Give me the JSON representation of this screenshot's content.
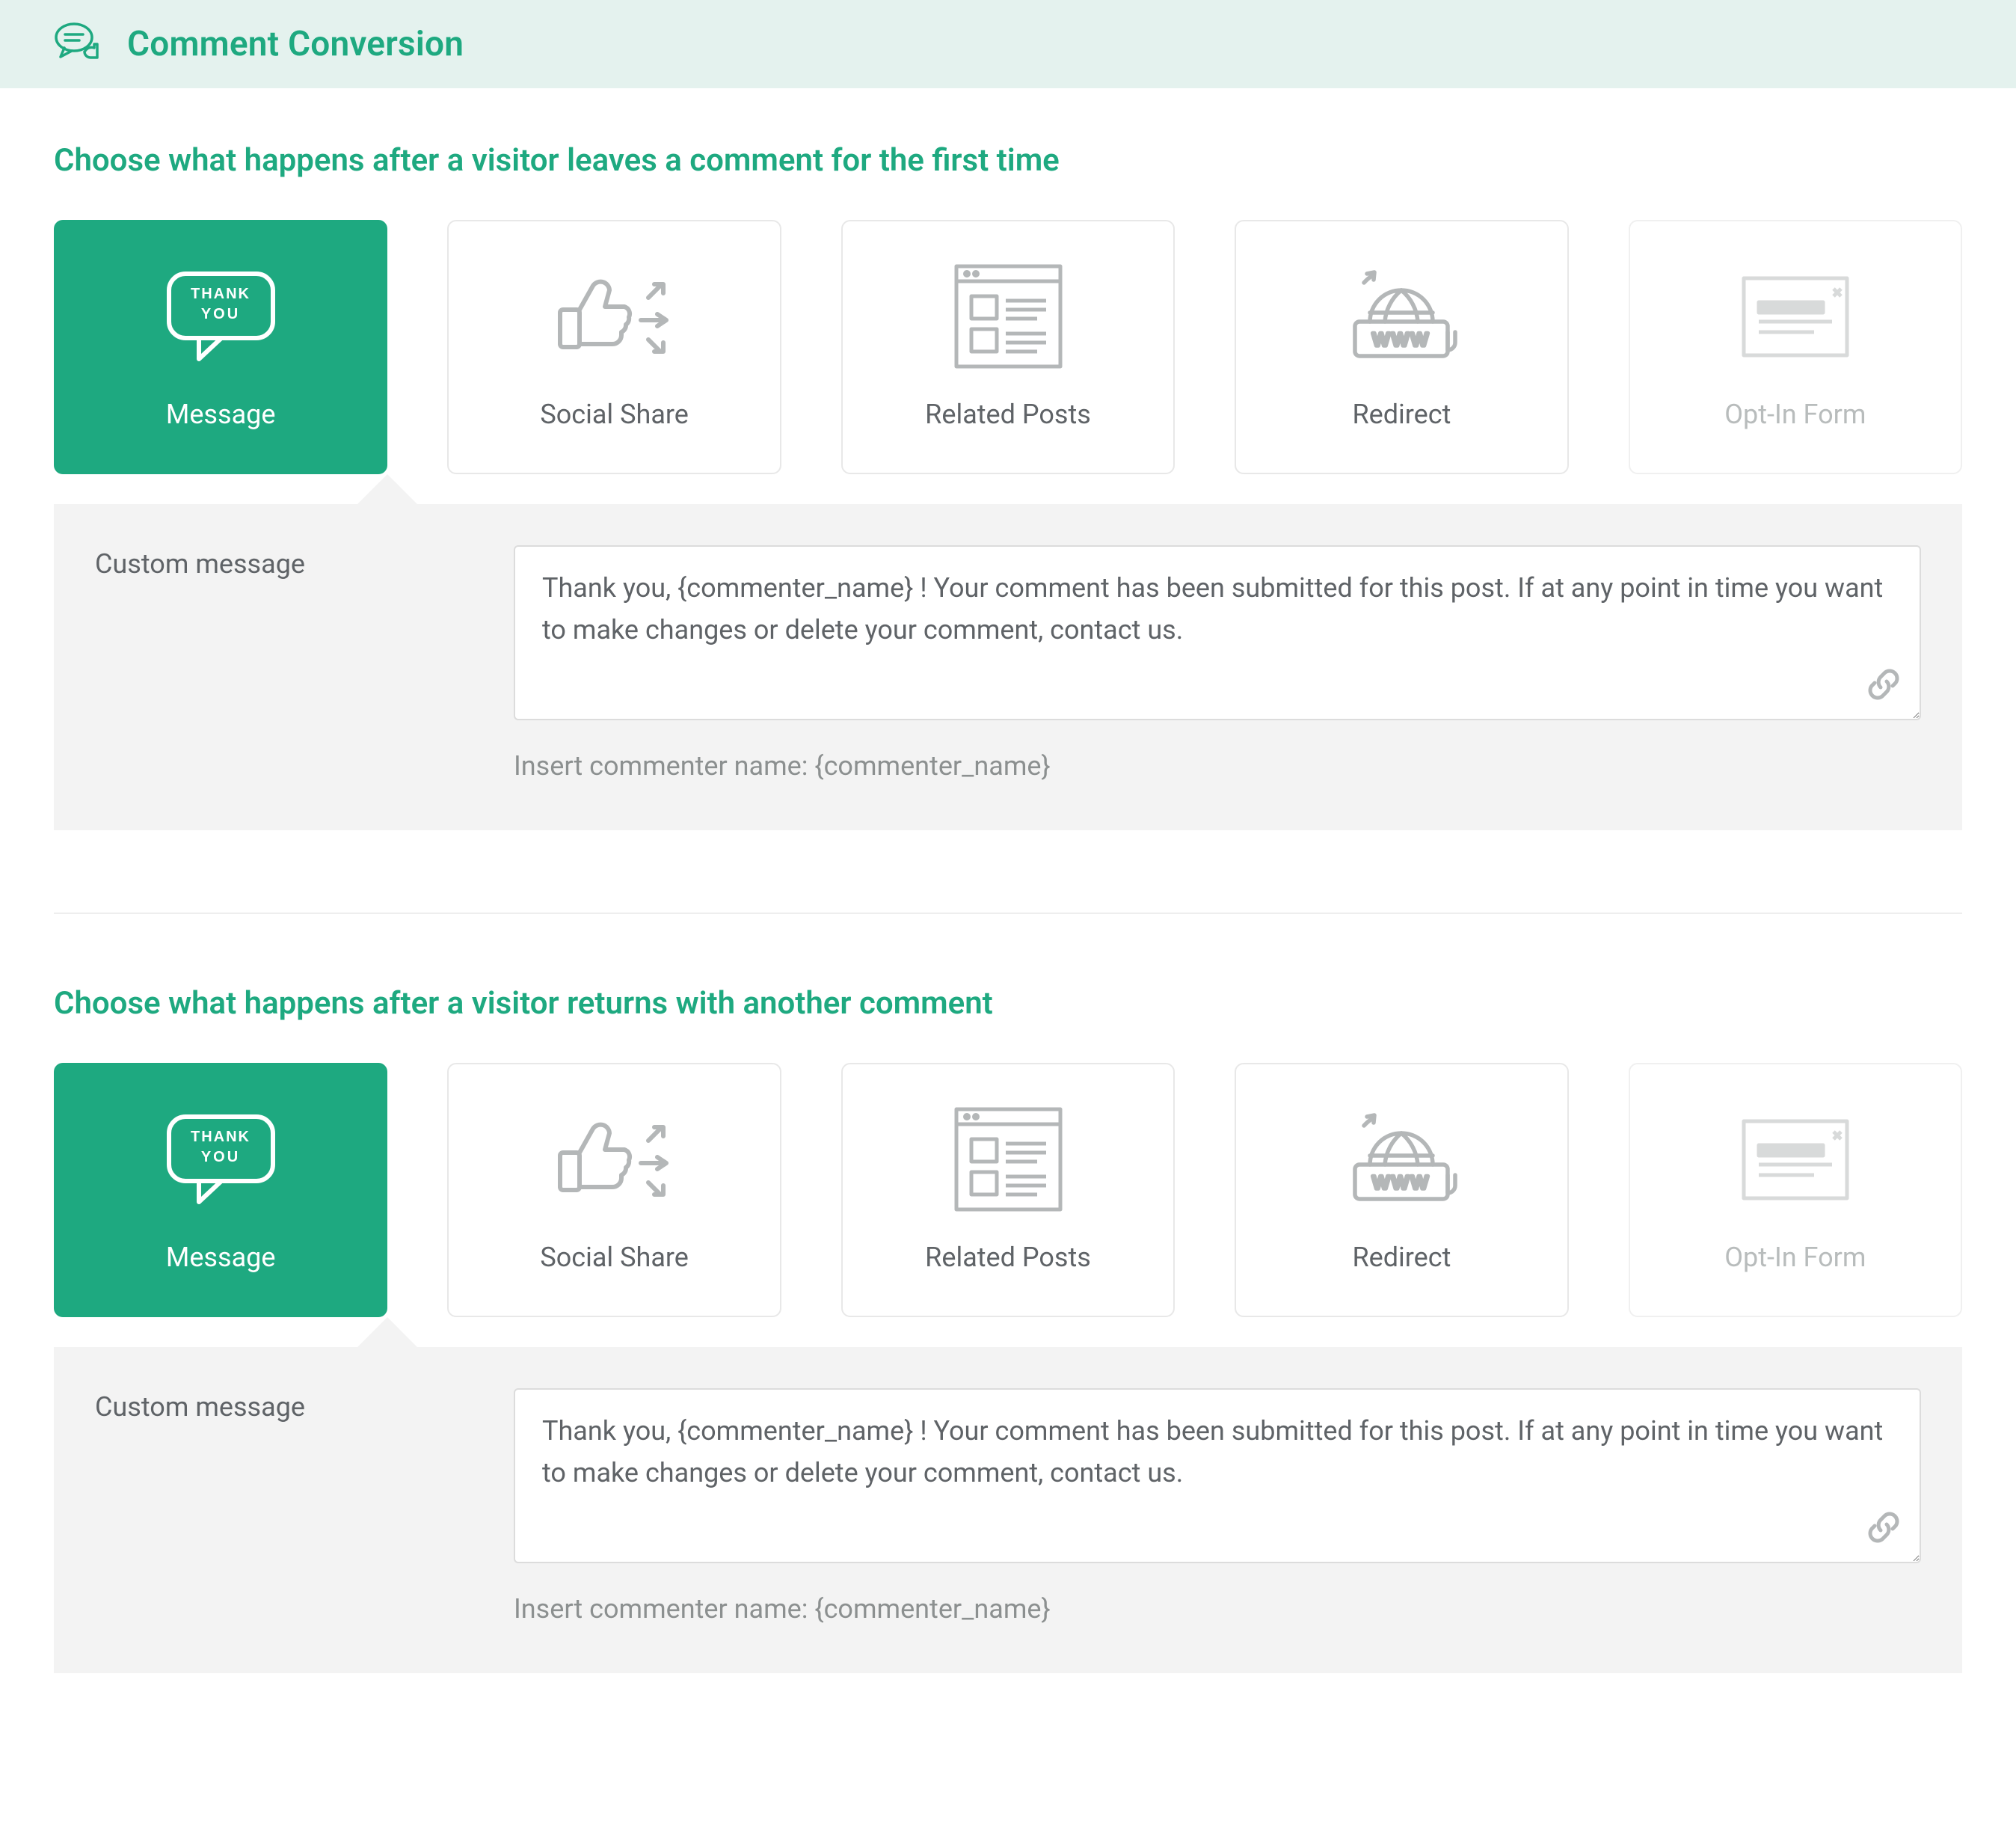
{
  "header": {
    "title": "Comment Conversion"
  },
  "colors": {
    "accent": "#1ea980",
    "headerBg": "#e4f2ee",
    "panelBg": "#f3f3f3"
  },
  "sections": [
    {
      "title": "Choose what happens after a visitor leaves a comment for the first time",
      "active_card": 0,
      "panel": {
        "label": "Custom message",
        "textarea_value": "Thank you, {commenter_name} ! Your comment has been submitted for this post. If at any point in time you want to make changes or delete your comment, contact us.",
        "hint": "Insert commenter name: {commenter_name}"
      }
    },
    {
      "title": "Choose what happens after a visitor returns with another comment",
      "active_card": 0,
      "panel": {
        "label": "Custom message",
        "textarea_value": "Thank you, {commenter_name} ! Your comment has been submitted for this post. If at any point in time you want to make changes or delete your comment, contact us.",
        "hint": "Insert commenter name: {commenter_name}"
      }
    }
  ],
  "cards": [
    {
      "id": "message",
      "label": "Message",
      "icon": "thank-you-bubble-icon",
      "disabled": false
    },
    {
      "id": "social-share",
      "label": "Social Share",
      "icon": "share-thumb-icon",
      "disabled": false
    },
    {
      "id": "related-posts",
      "label": "Related Posts",
      "icon": "related-posts-icon",
      "disabled": false
    },
    {
      "id": "redirect",
      "label": "Redirect",
      "icon": "redirect-globe-icon",
      "disabled": false
    },
    {
      "id": "optin-form",
      "label": "Opt-In Form",
      "icon": "optin-form-icon",
      "disabled": true
    }
  ]
}
